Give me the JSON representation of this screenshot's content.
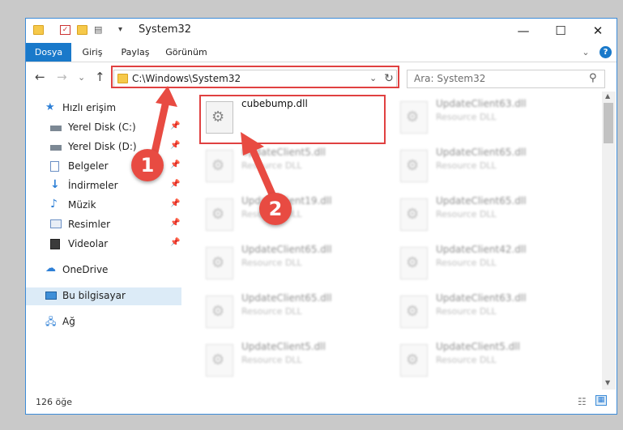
{
  "window": {
    "title": "System32",
    "minimize": "—",
    "maximize": "☐",
    "close": "✕"
  },
  "ribbon": {
    "tabs": [
      "Dosya",
      "Giriş",
      "Paylaş",
      "Görünüm"
    ],
    "expand": "⌄",
    "help": "?"
  },
  "nav": {
    "back": "←",
    "forward": "→",
    "recent": "⌄",
    "up": "↑",
    "address": "C:\\Windows\\System32",
    "dropdown": "⌄",
    "refresh": "↻",
    "search_placeholder": "Ara: System32"
  },
  "sidebar": {
    "quick_access": "Hızlı erişim",
    "items": [
      {
        "label": "Yerel Disk (C:)",
        "icon": "drive-icon",
        "pinned": true
      },
      {
        "label": "Yerel Disk (D:)",
        "icon": "drive-icon",
        "pinned": true
      },
      {
        "label": "Belgeler",
        "icon": "documents-icon",
        "pinned": true
      },
      {
        "label": "İndirmeler",
        "icon": "download-icon",
        "pinned": true
      },
      {
        "label": "Müzik",
        "icon": "music-icon",
        "pinned": true
      },
      {
        "label": "Resimler",
        "icon": "pictures-icon",
        "pinned": true
      },
      {
        "label": "Videolar",
        "icon": "videos-icon",
        "pinned": true
      }
    ],
    "onedrive": "OneDrive",
    "this_pc": "Bu bilgisayar",
    "network": "Ağ"
  },
  "files": [
    {
      "name": "cubebump.dll",
      "type": ""
    },
    {
      "name": "UpdateClient63.dll",
      "type": "Resource DLL"
    },
    {
      "name": "UpdateClient5.dll",
      "type": "Resource DLL"
    },
    {
      "name": "UpdateClient65.dll",
      "type": "Resource DLL"
    },
    {
      "name": "UpdateClient19.dll",
      "type": "Resource DLL"
    },
    {
      "name": "UpdateClient65.dll",
      "type": "Resource DLL"
    },
    {
      "name": "UpdateClient65.dll",
      "type": "Resource DLL"
    },
    {
      "name": "UpdateClient42.dll",
      "type": "Resource DLL"
    },
    {
      "name": "UpdateClient65.dll",
      "type": "Resource DLL"
    },
    {
      "name": "UpdateClient63.dll",
      "type": "Resource DLL"
    },
    {
      "name": "UpdateClient5.dll",
      "type": "Resource DLL"
    },
    {
      "name": "UpdateClient5.dll",
      "type": "Resource DLL"
    }
  ],
  "status": {
    "count": "126 öğe"
  },
  "annotations": {
    "badge1": "1",
    "badge2": "2"
  },
  "colors": {
    "accent": "#1979ca",
    "highlight": "#e04141",
    "badge": "#e84b42"
  }
}
